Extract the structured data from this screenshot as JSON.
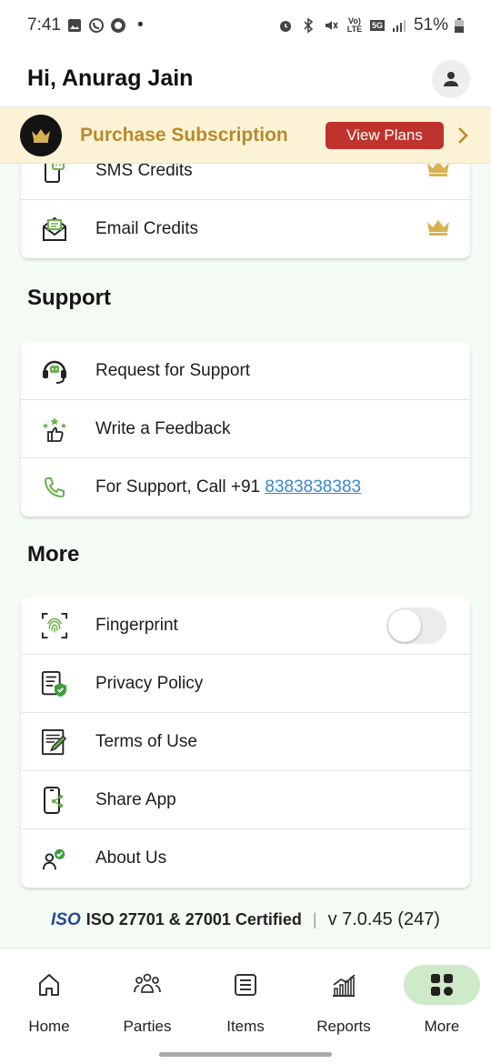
{
  "status_bar": {
    "time": "7:41",
    "dot": "•",
    "battery": "51%",
    "left_icons": [
      "gallery-icon",
      "whatsapp-icon",
      "record-icon"
    ],
    "right_icons": [
      "alarm-icon",
      "bluetooth-icon",
      "mute-icon",
      "volte-icon",
      "5g-icon",
      "signal-icon",
      "battery-icon"
    ],
    "volte_label": "Vo) LTE",
    "net_label": "5G"
  },
  "header": {
    "greeting": "Hi, Anurag Jain"
  },
  "banner": {
    "text": "Purchase Subscription",
    "button": "View Plans"
  },
  "credits": [
    {
      "label": "SMS Credits",
      "icon": "sms-icon"
    },
    {
      "label": "Email Credits",
      "icon": "email-icon"
    }
  ],
  "support": {
    "title": "Support",
    "items": [
      {
        "label": "Request for Support",
        "icon": "headset-icon"
      },
      {
        "label": "Write a Feedback",
        "icon": "feedback-icon"
      },
      {
        "label": "For Support, Call +91 ",
        "phone": "8383838383",
        "icon": "phone-icon"
      }
    ]
  },
  "more": {
    "title": "More",
    "items": [
      {
        "label": "Fingerprint",
        "icon": "fingerprint-icon",
        "toggle": false
      },
      {
        "label": "Privacy Policy",
        "icon": "privacy-icon"
      },
      {
        "label": "Terms of Use",
        "icon": "terms-icon"
      },
      {
        "label": "Share App",
        "icon": "share-icon"
      },
      {
        "label": "About Us",
        "icon": "about-icon"
      }
    ]
  },
  "footer": {
    "iso_logo": "ISO",
    "cert": "ISO 27701 & 27001 Certified",
    "version": "v 7.0.45 (247)"
  },
  "nav": [
    {
      "label": "Home",
      "icon": "home-icon",
      "active": false
    },
    {
      "label": "Parties",
      "icon": "parties-icon",
      "active": false
    },
    {
      "label": "Items",
      "icon": "items-icon",
      "active": false
    },
    {
      "label": "Reports",
      "icon": "reports-icon",
      "active": false
    },
    {
      "label": "More",
      "icon": "more-grid-icon",
      "active": true
    }
  ],
  "colors": {
    "accent_green": "#4caf50",
    "gold": "#b98a2b",
    "button_red": "#c0322d",
    "link_blue": "#3a86d4",
    "nav_active_bg": "#cfeac9"
  }
}
